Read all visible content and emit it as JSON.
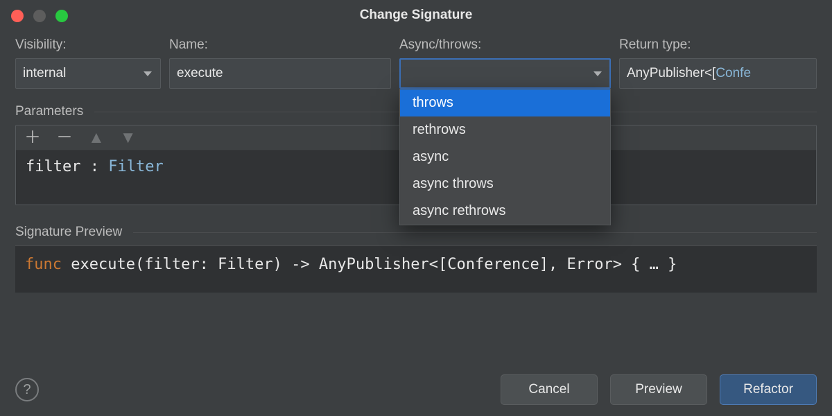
{
  "title": "Change Signature",
  "labels": {
    "visibility": "Visibility:",
    "name": "Name:",
    "async": "Async/throws:",
    "return_type": "Return type:"
  },
  "fields": {
    "visibility_value": "internal",
    "name_value": "execute",
    "async_value": "",
    "return_type_prefix": "AnyPublisher<[",
    "return_type_type": "Confe"
  },
  "dropdown": {
    "options": [
      "throws",
      "rethrows",
      "async",
      "async throws",
      "async rethrows"
    ],
    "selected_index": 0
  },
  "parameters": {
    "section_label": "Parameters",
    "row": {
      "name": "filter",
      "sep": " : ",
      "type": "Filter"
    }
  },
  "preview": {
    "section_label": "Signature Preview",
    "tokens": {
      "kw": "func",
      "rest": " execute(filter: Filter) -> AnyPublisher<[Conference], Error> { … }"
    }
  },
  "buttons": {
    "cancel": "Cancel",
    "preview": "Preview",
    "refactor": "Refactor"
  },
  "help": "?"
}
